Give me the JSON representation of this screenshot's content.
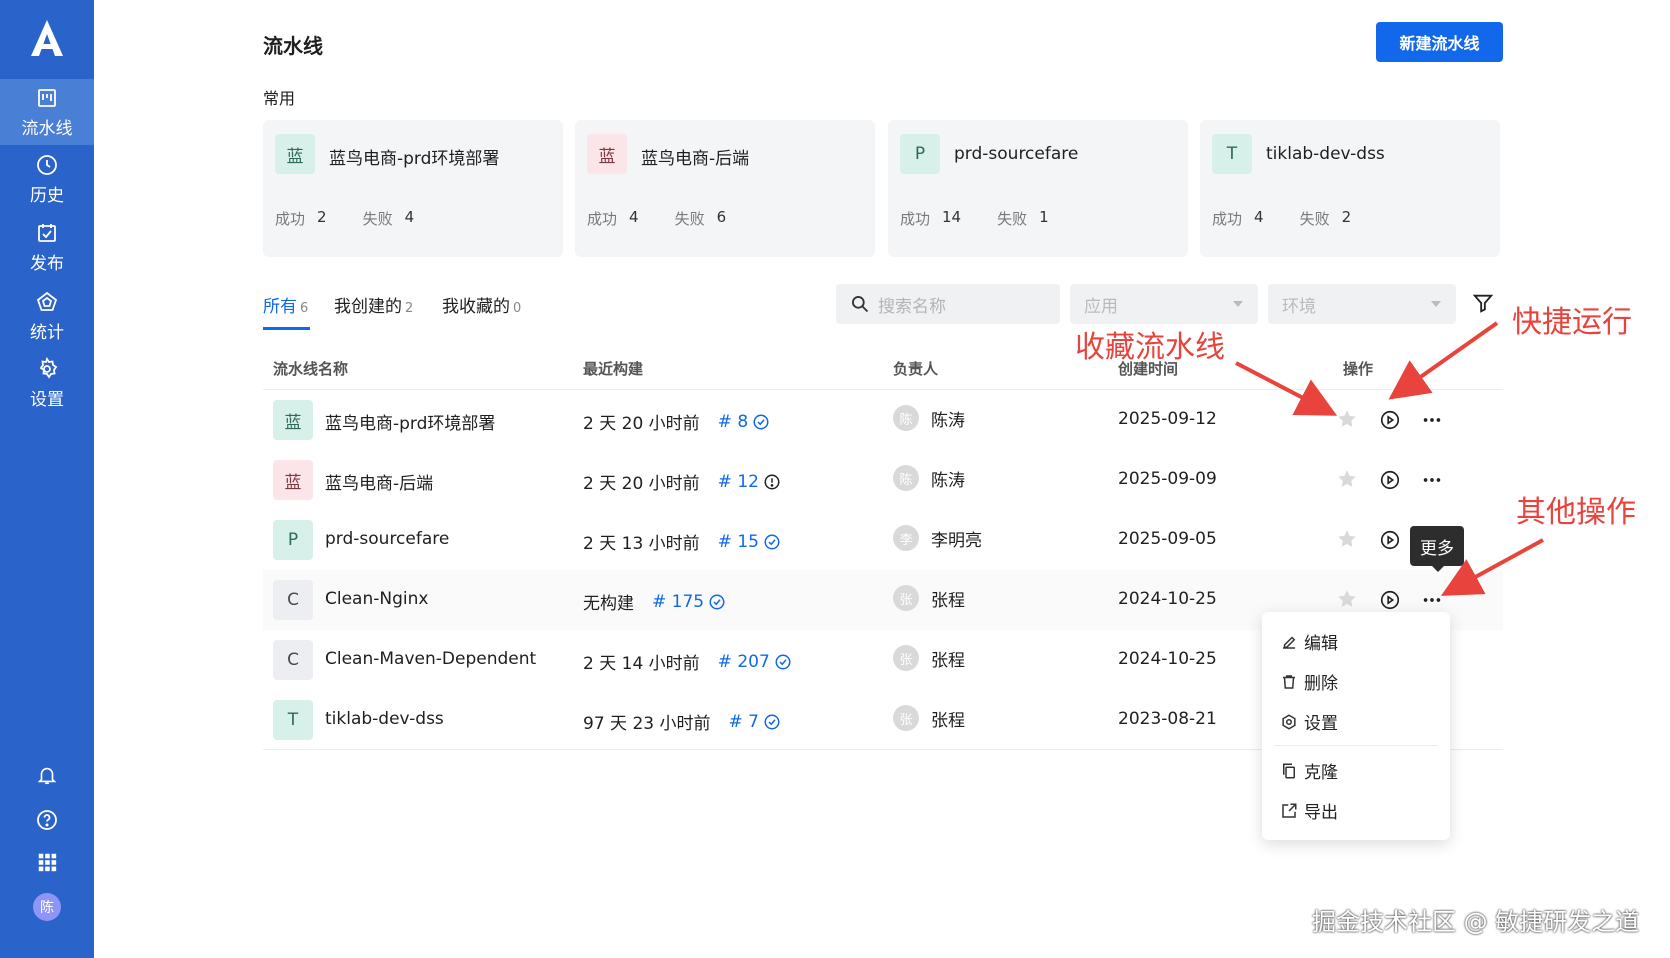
{
  "sidebar": {
    "logo": "A",
    "items": [
      {
        "label": "流水线",
        "icon": "pipeline-icon"
      },
      {
        "label": "历史",
        "icon": "clock-icon"
      },
      {
        "label": "发布",
        "icon": "release-icon"
      },
      {
        "label": "统计",
        "icon": "stats-icon"
      },
      {
        "label": "设置",
        "icon": "gear-icon"
      }
    ],
    "avatar": "陈"
  },
  "header": {
    "title": "流水线",
    "new_button": "新建流水线"
  },
  "favorites": {
    "label": "常用",
    "success_label": "成功",
    "fail_label": "失败",
    "cards": [
      {
        "badge": "蓝",
        "name": "蓝鸟电商-prd环境部署",
        "success": "2",
        "fail": "4"
      },
      {
        "badge": "蓝",
        "name": "蓝鸟电商-后端",
        "success": "4",
        "fail": "6"
      },
      {
        "badge": "P",
        "name": "prd-sourcefare",
        "success": "14",
        "fail": "1"
      },
      {
        "badge": "T",
        "name": "tiklab-dev-dss",
        "success": "4",
        "fail": "2"
      }
    ]
  },
  "tabs": [
    {
      "label": "所有",
      "count": "6"
    },
    {
      "label": "我创建的",
      "count": "2"
    },
    {
      "label": "我收藏的",
      "count": "0"
    }
  ],
  "filters": {
    "search_placeholder": "搜索名称",
    "app_placeholder": "应用",
    "env_placeholder": "环境"
  },
  "table": {
    "columns": [
      "流水线名称",
      "最近构建",
      "负责人",
      "创建时间",
      "操作"
    ],
    "rows": [
      {
        "badge": "蓝",
        "name": "蓝鸟电商-prd环境部署",
        "last_build": "2 天 20 小时前",
        "build_no": "# 8",
        "status": "success",
        "owner_avatar": "陈",
        "owner": "陈涛",
        "created": "2025-09-12"
      },
      {
        "badge": "蓝",
        "name": "蓝鸟电商-后端",
        "last_build": "2 天 20 小时前",
        "build_no": "# 12",
        "status": "failed",
        "owner_avatar": "陈",
        "owner": "陈涛",
        "created": "2025-09-09"
      },
      {
        "badge": "P",
        "name": "prd-sourcefare",
        "last_build": "2 天 13 小时前",
        "build_no": "# 15",
        "status": "success",
        "owner_avatar": "李",
        "owner": "李明亮",
        "created": "2025-09-05"
      },
      {
        "badge": "C",
        "name": "Clean-Nginx",
        "last_build": "无构建",
        "build_no": "# 175",
        "status": "success",
        "owner_avatar": "张",
        "owner": "张程",
        "created": "2024-10-25"
      },
      {
        "badge": "C",
        "name": "Clean-Maven-Dependent",
        "last_build": "2 天 14 小时前",
        "build_no": "# 207",
        "status": "success",
        "owner_avatar": "张",
        "owner": "张程",
        "created": "2024-10-25"
      },
      {
        "badge": "T",
        "name": "tiklab-dev-dss",
        "last_build": "97 天 23 小时前",
        "build_no": "# 7",
        "status": "success",
        "owner_avatar": "张",
        "owner": "张程",
        "created": "2023-08-21"
      }
    ]
  },
  "tooltip": "更多",
  "more_menu": [
    {
      "label": "编辑",
      "icon": "edit-icon"
    },
    {
      "label": "删除",
      "icon": "trash-icon"
    },
    {
      "label": "设置",
      "icon": "gear-icon"
    },
    {
      "label": "克隆",
      "icon": "copy-icon"
    },
    {
      "label": "导出",
      "icon": "export-icon"
    }
  ],
  "annotations": {
    "favorite": "收藏流水线",
    "quick_run": "快捷运行",
    "other": "其他操作"
  },
  "watermark": "掘金技术社区 @ 敏捷研发之道",
  "colors": {
    "sidebar": "#2a63c9",
    "primary": "#1268ea",
    "annotation": "#e8443d"
  }
}
